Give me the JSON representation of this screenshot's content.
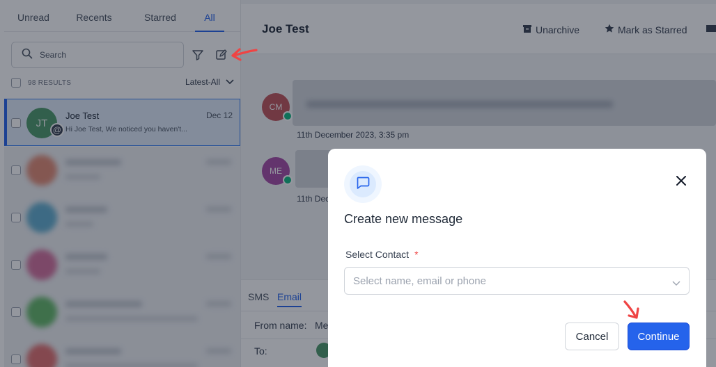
{
  "sidebar": {
    "tabs": [
      {
        "label": "Unread"
      },
      {
        "label": "Recents"
      },
      {
        "label": "Starred"
      },
      {
        "label": "All"
      }
    ],
    "search_placeholder": "Search",
    "results_count": "98 RESULTS",
    "sort_label": "Latest-All",
    "conversations": [
      {
        "initials": "JT",
        "name": "Joe Test",
        "date": "Dec 12",
        "preview": "Hi Joe Test, We noticed you haven't...",
        "avatar_color": "#4e9a6a",
        "selected": true
      },
      {
        "initials": "",
        "name": "",
        "date": "",
        "preview": "",
        "avatar_color": "#e07a5f",
        "blurred": true
      },
      {
        "initials": "",
        "name": "",
        "date": "",
        "preview": "",
        "avatar_color": "#4aa3c9",
        "blurred": true
      },
      {
        "initials": "",
        "name": "",
        "date": "",
        "preview": "",
        "avatar_color": "#d05a8f",
        "blurred": true
      },
      {
        "initials": "",
        "name": "",
        "date": "",
        "preview": "",
        "avatar_color": "#4caf50",
        "blurred": true
      },
      {
        "initials": "",
        "name": "",
        "date": "",
        "preview": "",
        "avatar_color": "#e05a5a",
        "blurred": true
      }
    ]
  },
  "conversation": {
    "title": "Joe Test",
    "actions": [
      {
        "label": "Unarchive",
        "icon": "archive-box-icon"
      },
      {
        "label": "Mark as Starred",
        "icon": "star-icon"
      }
    ],
    "messages": [
      {
        "initials": "CM",
        "avatar_color": "#c0545a",
        "timestamp": "11th December 2023, 3:35 pm"
      },
      {
        "initials": "ME",
        "avatar_color": "#a64ca6",
        "timestamp": "11th Dec"
      }
    ]
  },
  "composer": {
    "tabs": [
      {
        "label": "SMS"
      },
      {
        "label": "Email"
      }
    ],
    "from_label": "From name:",
    "from_value": "Me",
    "to_label": "To:"
  },
  "modal": {
    "title": "Create new message",
    "contact_label": "Select Contact",
    "required_mark": "*",
    "contact_placeholder": "Select name, email or phone",
    "cancel_label": "Cancel",
    "continue_label": "Continue",
    "accent_color": "#2563eb"
  },
  "annotations": {
    "arrow_color": "#ef4444"
  }
}
